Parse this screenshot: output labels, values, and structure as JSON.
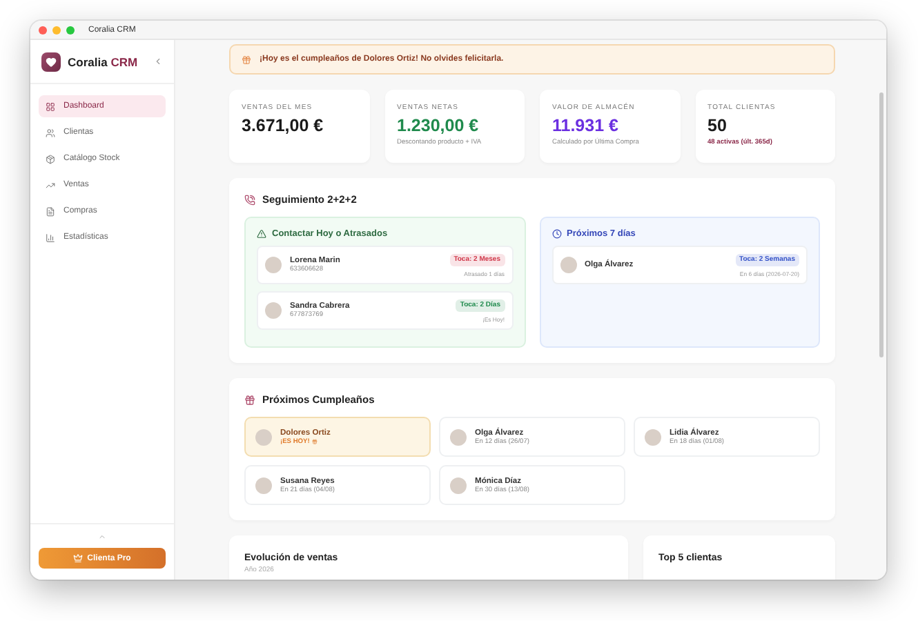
{
  "window": {
    "title": "Coralia CRM"
  },
  "sidebar": {
    "brand": "Coralia",
    "brand_accent": "CRM",
    "items": [
      {
        "label": "Dashboard",
        "selected": true
      },
      {
        "label": "Clientas",
        "selected": false
      },
      {
        "label": "Catálogo Stock",
        "selected": false
      },
      {
        "label": "Ventas",
        "selected": false
      },
      {
        "label": "Compras",
        "selected": false
      },
      {
        "label": "Estadísticas",
        "selected": false
      }
    ],
    "pro_button": "Clienta Pro"
  },
  "banner": "¡Hoy es el cumpleaños de Dolores Ortiz! No olvides felicitarla.",
  "stats": [
    {
      "label": "VENTAS DEL MES",
      "value": "3.671,00 €",
      "color": "#1a1a1a"
    },
    {
      "label": "VENTAS NETAS",
      "value": "1.230,00 €",
      "color": "#1f8a4c",
      "note": "Descontando producto + IVA",
      "note_accent": false
    },
    {
      "label": "VALOR DE ALMACÉN",
      "value": "11.931 €",
      "color": "#6b2fe0",
      "note": "Calculado por Última Compra",
      "note_accent": false
    },
    {
      "label": "TOTAL CLIENTAS",
      "value": "50",
      "color": "#1a1a1a",
      "note": "48 activas (últ. 365d)",
      "note_accent": true
    }
  ],
  "followup": {
    "title": "Seguimiento 2+2+2",
    "overdue": {
      "title": "Contactar Hoy o Atrasados",
      "contacts": [
        {
          "name": "Lorena Marin",
          "phone": "633606628",
          "badge": "Toca: 2 Meses",
          "color": "#d0384a",
          "note": "Atrasado 1 días"
        },
        {
          "name": "Sandra Cabrera",
          "phone": "677873769",
          "badge": "Toca: 2 Días",
          "color": "#1f8a4c",
          "note": "¡Es Hoy!"
        }
      ]
    },
    "upcoming": {
      "title": "Próximos 7 días",
      "contacts": [
        {
          "name": "Olga Álvarez",
          "badge": "Toca: 2 Semanas",
          "color": "#3553c8",
          "note": "En 6 días (2026-07-20)"
        }
      ]
    }
  },
  "birthdays": {
    "title": "Próximos Cumpleaños",
    "items": [
      {
        "name": "Dolores Ortiz",
        "note": "¡ES HOY!",
        "today": true
      },
      {
        "name": "Olga Álvarez",
        "note": "En 12 días (26/07)",
        "today": false
      },
      {
        "name": "Lidia Álvarez",
        "note": "En 18 días (01/08)",
        "today": false
      },
      {
        "name": "Susana Reyes",
        "note": "En 21 días (04/08)",
        "today": false
      },
      {
        "name": "Mónica Díaz",
        "note": "En 30 días (13/08)",
        "today": false
      }
    ]
  },
  "panels": [
    {
      "title": "Evolución de ventas",
      "subtitle": "Año 2026"
    },
    {
      "title": "Top 5 clientas"
    }
  ]
}
